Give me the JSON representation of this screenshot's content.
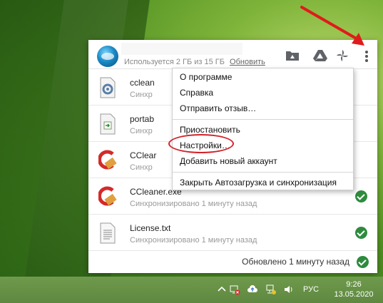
{
  "panel": {
    "header": {
      "usage_text": "Используется 2 ГБ из 15 ГБ",
      "upgrade_link": "Обновить"
    },
    "files": [
      {
        "name": "cclean",
        "status": "Синхр",
        "icon": "settings-file-icon",
        "synced": false
      },
      {
        "name": "portab",
        "status": "Синхр",
        "icon": "exe-file-icon",
        "synced": false
      },
      {
        "name": "CClear",
        "status": "Синхр",
        "icon": "ccleaner-icon",
        "synced": false
      },
      {
        "name": "CCleaner.exe",
        "status": "Синхронизировано 1 минуту назад",
        "icon": "ccleaner-icon",
        "synced": true
      },
      {
        "name": "License.txt",
        "status": "Синхронизировано 1 минуту назад",
        "icon": "text-file-icon",
        "synced": true
      }
    ],
    "footer_text": "Обновлено 1 минуту назад"
  },
  "menu": {
    "about": "О программе",
    "help": "Справка",
    "feedback": "Отправить отзыв…",
    "pause": "Приостановить",
    "settings": "Настройки…",
    "add_account": "Добавить новый аккаунт",
    "quit": "Закрыть Автозагрузка и синхронизация"
  },
  "taskbar": {
    "language": "РУС",
    "time": "9:26",
    "date": "13.05.2020"
  },
  "colors": {
    "accent_red": "#d5222a",
    "synced_green": "#2e8b3e"
  }
}
